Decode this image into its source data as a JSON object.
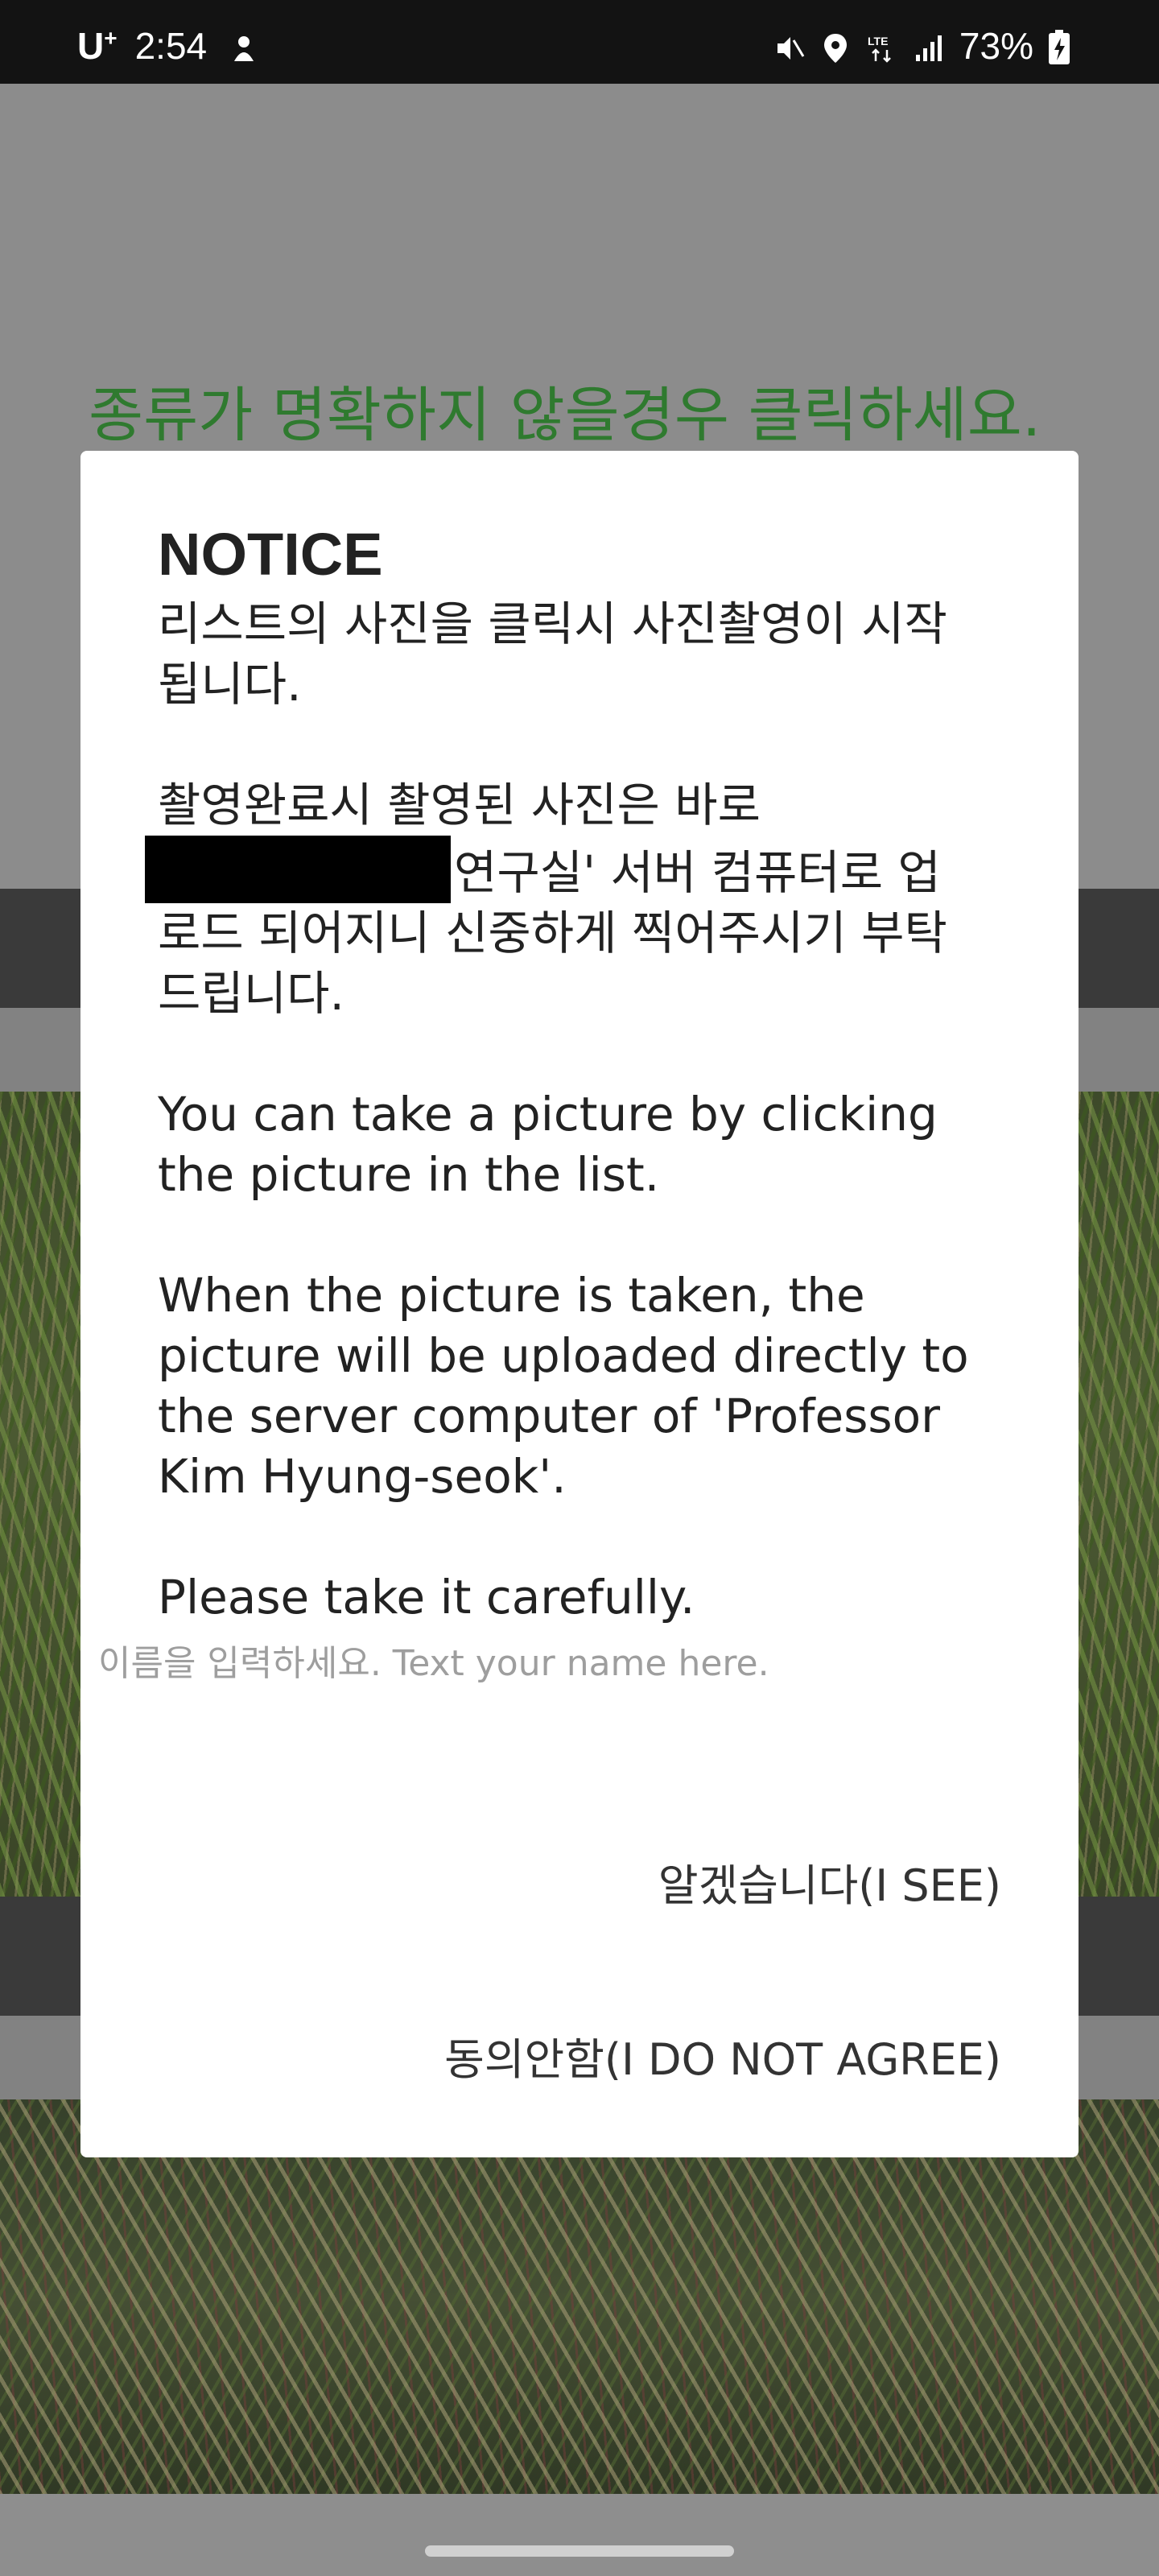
{
  "status_bar": {
    "carrier": "U",
    "carrier_sup": "+",
    "time": "2:54",
    "battery": "73%",
    "icons": [
      "mute-icon",
      "location-icon",
      "lte-icon",
      "signal-icon",
      "battery-icon"
    ]
  },
  "background_app": {
    "prompt": "종류가 명확하지 않을경우 클릭하세요."
  },
  "dialog": {
    "title": "NOTICE",
    "paragraphs": {
      "p1": "리스트의 사진을 클릭시 사진촬영이 시작됩니다.",
      "p2_before": "촬영완료시 촬영된 사진은 바로",
      "p2_after": "연구실' 서버 컴퓨터로 업로드 되어지니 신중하게 찍어주시기 부탁드립니다.",
      "p3": "You can take a picture by clicking the picture in the list.",
      "p4": "When the picture is taken, the picture will be uploaded directly to the server computer of 'Professor Kim Hyung-seok'.",
      "p5": "Please take it carefully."
    },
    "name_input": {
      "placeholder": "이름을 입력하세요. Text your name here.",
      "value": ""
    },
    "buttons": {
      "see": "알겠습니다(I SEE)",
      "disagree": "동의안함(I DO NOT AGREE)"
    }
  },
  "colors": {
    "prompt_green": "#2f7a2f",
    "dialog_bg": "#ffffff",
    "status_bar_bg": "#131313"
  }
}
